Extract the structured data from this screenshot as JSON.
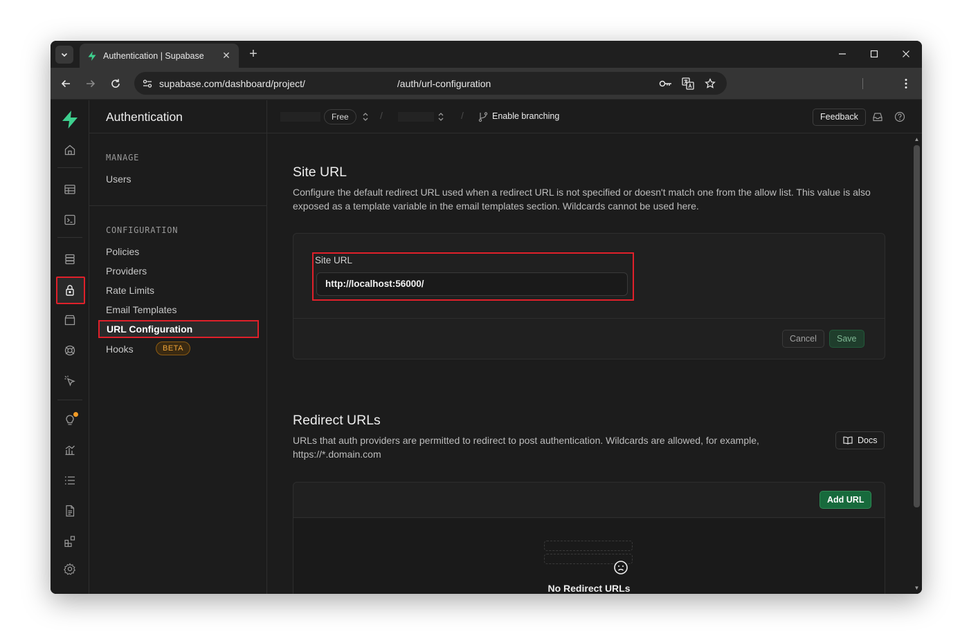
{
  "browser": {
    "tab_title": "Authentication | Supabase",
    "url_prefix": "supabase.com/dashboard/project/",
    "url_suffix": "/auth/url-configuration"
  },
  "menu": {
    "title": "Authentication",
    "sections": [
      {
        "label": "MANAGE",
        "items": [
          "Users"
        ]
      },
      {
        "label": "CONFIGURATION",
        "items": [
          "Policies",
          "Providers",
          "Rate Limits",
          "Email Templates",
          "URL Configuration",
          "Hooks"
        ]
      }
    ],
    "active_item": "URL Configuration",
    "hooks_badge": "BETA"
  },
  "topbar": {
    "plan": "Free",
    "branching": "Enable branching",
    "feedback": "Feedback"
  },
  "site_url": {
    "title": "Site URL",
    "description": "Configure the default redirect URL used when a redirect URL is not specified or doesn't match one from the allow list. This value is also exposed as a template variable in the email templates section. Wildcards cannot be used here.",
    "field_label": "Site URL",
    "field_value": "http://localhost:56000/",
    "cancel": "Cancel",
    "save": "Save"
  },
  "redirect_urls": {
    "title": "Redirect URLs",
    "description": "URLs that auth providers are permitted to redirect to post authentication. Wildcards are allowed, for example, https://*.domain.com",
    "docs": "Docs",
    "add_url": "Add URL",
    "empty": "No Redirect URLs"
  },
  "colors": {
    "brand": "#3ecf8e",
    "highlight": "#e0202a",
    "warning": "#f29b26"
  }
}
